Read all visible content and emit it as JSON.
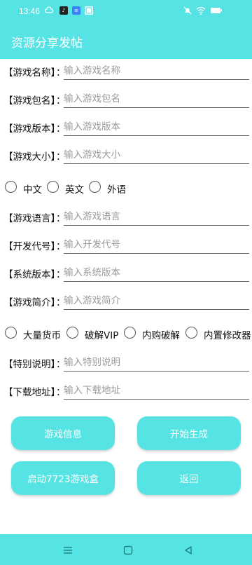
{
  "status_bar": {
    "time": "13:46",
    "left_icons": [
      "cloud-icon",
      "tiktok-icon",
      "app-icon",
      "app-icon-2"
    ],
    "right_icons": [
      "mute-icon",
      "wifi-icon",
      "battery-icon"
    ]
  },
  "app_bar": {
    "title": "资源分享发帖"
  },
  "form": {
    "colon": "：",
    "game_name": {
      "label": "【游戏名称】",
      "placeholder": "输入游戏名称"
    },
    "package_name": {
      "label": "【游戏包名】",
      "placeholder": "输入游戏包名"
    },
    "game_version": {
      "label": "【游戏版本】",
      "placeholder": "输入游戏版本"
    },
    "game_size": {
      "label": "【游戏大小】",
      "placeholder": "输入游戏大小"
    },
    "language_options": [
      "中文",
      "英文",
      "外语"
    ],
    "game_language": {
      "label": "【游戏语言】",
      "placeholder": "输入游戏语言"
    },
    "dev_code": {
      "label": "【开发代号】",
      "placeholder": "输入开发代号"
    },
    "system_version": {
      "label": "【系统版本】",
      "placeholder": "输入系统版本"
    },
    "game_intro": {
      "label": "【游戏简介】",
      "placeholder": "输入游戏简介"
    },
    "feature_options": [
      "大量货币",
      "破解VIP",
      "内购破解",
      "内置修改器"
    ],
    "special_notes": {
      "label": "【特别说明】",
      "placeholder": "输入特别说明"
    },
    "download_url": {
      "label": "【下载地址】",
      "placeholder": "输入下载地址"
    }
  },
  "buttons": {
    "game_info": "游戏信息",
    "start_generate": "开始生成",
    "launch_box": "启动7723游戏盒",
    "back": "返回"
  },
  "nav_bar": {
    "icons": [
      "menu-icon",
      "home-icon",
      "back-icon"
    ]
  },
  "colors": {
    "accent": "#56e3e3",
    "text": "#111111",
    "placeholder": "#9a9a9a"
  }
}
